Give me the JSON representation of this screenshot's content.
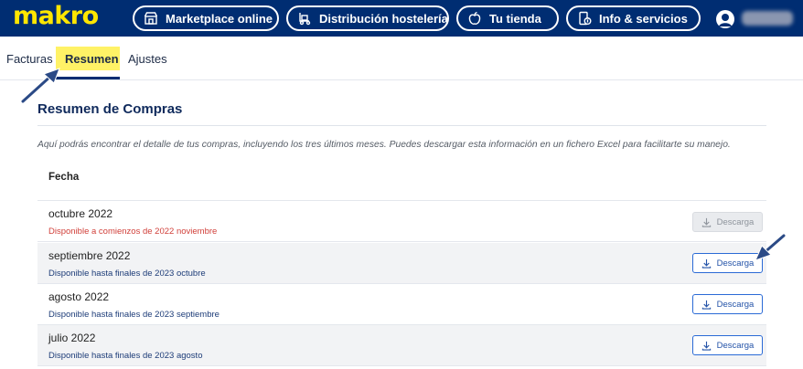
{
  "header": {
    "logo": "makro",
    "nav": [
      {
        "label": "Marketplace online",
        "icon": "storefront-icon"
      },
      {
        "label": "Distribución hostelería",
        "icon": "delivery-truck-icon"
      },
      {
        "label": "Tu tienda",
        "icon": "apple-icon"
      },
      {
        "label": "Info & servicios",
        "icon": "info-phone-icon"
      }
    ],
    "account_icon": "user-avatar-icon"
  },
  "tabs": [
    {
      "label": "Facturas",
      "active": false
    },
    {
      "label": "Resumen",
      "active": true
    },
    {
      "label": "Ajustes",
      "active": false
    }
  ],
  "summary": {
    "title": "Resumen de Compras",
    "description": "Aquí podrás encontrar el detalle de tus compras, incluyendo los tres últimos meses. Puedes descargar esta información en un fichero Excel para facilitarte su manejo.",
    "column_header": "Fecha",
    "rows": [
      {
        "month": "octubre 2022",
        "status": "Disponible a comienzos de 2022 noviembre",
        "button": "Descarga",
        "available": false
      },
      {
        "month": "septiembre 2022",
        "status": "Disponible hasta finales de 2023 octubre",
        "button": "Descarga",
        "available": true
      },
      {
        "month": "agosto 2022",
        "status": "Disponible hasta finales de 2023 septiembre",
        "button": "Descarga",
        "available": true
      },
      {
        "month": "julio 2022",
        "status": "Disponible hasta finales de 2023 agosto",
        "button": "Descarga",
        "available": true
      }
    ]
  },
  "colors": {
    "brand_blue": "#002d72",
    "brand_yellow": "#ffe600",
    "highlight": "#fff266",
    "pending_red": "#d1403a",
    "button_blue": "#2a6ad6"
  }
}
